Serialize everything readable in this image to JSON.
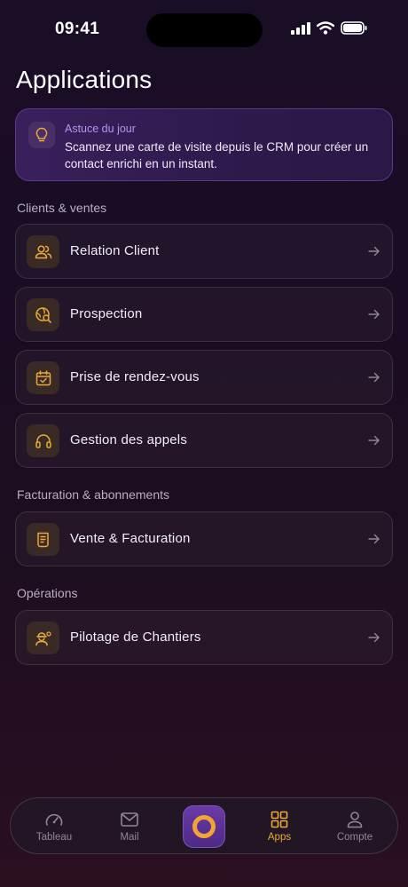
{
  "status": {
    "time": "09:41"
  },
  "page": {
    "title": "Applications"
  },
  "tip": {
    "label": "Astuce du jour",
    "text": "Scannez une carte de visite depuis le CRM pour créer un contact enrichi en un instant."
  },
  "sections": [
    {
      "title": "Clients & ventes",
      "items": [
        {
          "label": "Relation Client",
          "icon": "users-icon"
        },
        {
          "label": "Prospection",
          "icon": "globe-search-icon"
        },
        {
          "label": "Prise de rendez-vous",
          "icon": "calendar-check-icon"
        },
        {
          "label": "Gestion des appels",
          "icon": "headset-icon"
        }
      ]
    },
    {
      "title": "Facturation & abonnements",
      "items": [
        {
          "label": "Vente & Facturation",
          "icon": "receipt-icon"
        }
      ]
    },
    {
      "title": "Opérations",
      "items": [
        {
          "label": "Pilotage de Chantiers",
          "icon": "worker-icon"
        }
      ]
    }
  ],
  "tabbar": {
    "tabs": [
      {
        "label": "Tableau",
        "icon": "gauge-icon"
      },
      {
        "label": "Mail",
        "icon": "mail-icon"
      },
      {
        "label": "Apps",
        "icon": "grid-icon"
      },
      {
        "label": "Compte",
        "icon": "user-icon"
      }
    ],
    "active": "Apps"
  },
  "colors": {
    "accent": "#e8a93a",
    "tip_label": "#b892f0",
    "background_top": "#1a0d26",
    "background_bottom": "#2a0f1f"
  }
}
